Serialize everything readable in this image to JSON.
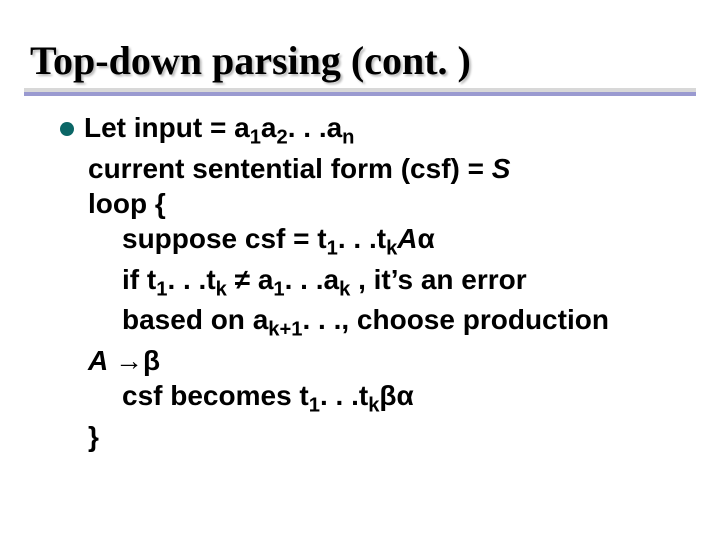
{
  "title": "Top-down parsing (cont. )",
  "body": {
    "l1_a": "Let input = a",
    "l1_sub1": "1",
    "l1_b": "a",
    "l1_sub2": "2",
    "l1_c": ". . .a",
    "l1_subn": "n",
    "l2_a": "current sentential form (csf) = ",
    "l2_b": "S",
    "l3": "loop {",
    "l4_a": "suppose csf = t",
    "l4_sub1": "1",
    "l4_b": ". . .t",
    "l4_subk": "k",
    "l4_c": "A",
    "l4_alpha": "α",
    "l5_a": "if t",
    "l5_sub1": "1",
    "l5_b": ". . .t",
    "l5_subk": "k",
    "l5_ne": " ≠ ",
    "l5_c": "a",
    "l5_sub1b": "1",
    "l5_d": ". . .a",
    "l5_subkb": "k",
    "l5_e": " , it’s an error",
    "l6_a": "based on a",
    "l6_sub": "k+1",
    "l6_b": ". . ., choose production",
    "l7_a": "A ",
    "l7_arrow": "→",
    "l7_beta": "β",
    "l8_a": "csf becomes t",
    "l8_sub1": "1",
    "l8_b": ". . .t",
    "l8_subk": "k",
    "l8_beta": "β",
    "l8_alpha": "α",
    "l9": "}"
  }
}
